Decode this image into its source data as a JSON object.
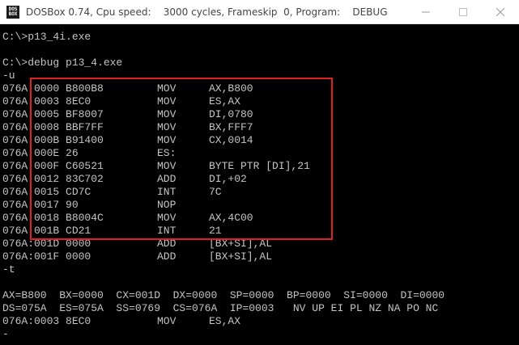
{
  "window": {
    "icon_text": "DOS BOX",
    "title": "DOSBox 0.74, Cpu speed:    3000 cycles, Frameskip  0, Program:    DEBUG",
    "minimize_icon": "minimize-icon",
    "maximize_icon": "maximize-icon",
    "close_icon": "close-icon"
  },
  "terminal": {
    "blank_line": "",
    "cmd1": "C:\\>p13_4i.exe",
    "cmd2": "C:\\>debug p13_4.exe",
    "cmd_u": "-u",
    "disasm": [
      {
        "addr": "076A:0000 B800B8",
        "mnem": "MOV",
        "ops": "AX,B800"
      },
      {
        "addr": "076A:0003 8EC0",
        "mnem": "MOV",
        "ops": "ES,AX"
      },
      {
        "addr": "076A:0005 BF8007",
        "mnem": "MOV",
        "ops": "DI,0780"
      },
      {
        "addr": "076A:0008 BBF7FF",
        "mnem": "MOV",
        "ops": "BX,FFF7"
      },
      {
        "addr": "076A:000B B91400",
        "mnem": "MOV",
        "ops": "CX,0014"
      },
      {
        "addr": "076A:000E 26",
        "mnem": "ES:",
        "ops": ""
      },
      {
        "addr": "076A:000F C60521",
        "mnem": "MOV",
        "ops": "BYTE PTR [DI],21"
      },
      {
        "addr": "076A:0012 83C702",
        "mnem": "ADD",
        "ops": "DI,+02"
      },
      {
        "addr": "076A:0015 CD7C",
        "mnem": "INT",
        "ops": "7C"
      },
      {
        "addr": "076A:0017 90",
        "mnem": "NOP",
        "ops": ""
      },
      {
        "addr": "076A:0018 B8004C",
        "mnem": "MOV",
        "ops": "AX,4C00"
      },
      {
        "addr": "076A:001B CD21",
        "mnem": "INT",
        "ops": "21"
      },
      {
        "addr": "076A:001D 0000",
        "mnem": "ADD",
        "ops": "[BX+SI],AL"
      },
      {
        "addr": "076A:001F 0000",
        "mnem": "ADD",
        "ops": "[BX+SI],AL"
      }
    ],
    "cmd_t": "-t",
    "regs1": "AX=B800  BX=0000  CX=001D  DX=0000  SP=0000  BP=0000  SI=0000  DI=0000",
    "regs2": "DS=075A  ES=075A  SS=0769  CS=076A  IP=0003   NV UP EI PL NZ NA PO NC",
    "next": {
      "addr": "076A:0003 8EC0",
      "mnem": "MOV",
      "ops": "ES,AX"
    },
    "prompt": "-"
  },
  "colors": {
    "terminal_bg": "#000000",
    "terminal_text": "#c4c4c4",
    "highlight_border": "#e02020"
  }
}
